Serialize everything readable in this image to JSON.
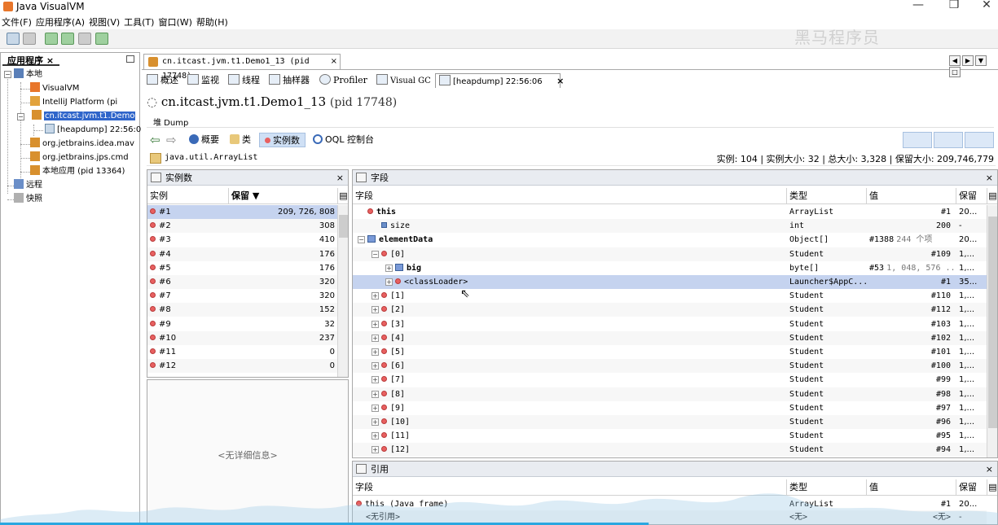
{
  "window": {
    "title": "Java VisualVM",
    "min": "—",
    "max": "❐",
    "close": "✕"
  },
  "menu": [
    "文件(F)",
    "应用程序(A)",
    "视图(V)",
    "工具(T)",
    "窗口(W)",
    "帮助(H)"
  ],
  "watermark": "黑马程序员",
  "app_panel": {
    "tab": "应用程序",
    "tab_close": "×",
    "tree": [
      {
        "label": "本地",
        "level": 0
      },
      {
        "label": "VisualVM",
        "level": 2
      },
      {
        "label": "IntelliJ Platform (pi",
        "level": 2
      },
      {
        "label": "cn.itcast.jvm.t1.Demo",
        "level": 2,
        "selected": true
      },
      {
        "label": "[heapdump] 22:56:0",
        "level": 3
      },
      {
        "label": "org.jetbrains.idea.mav",
        "level": 2
      },
      {
        "label": "org.jetbrains.jps.cmd",
        "level": 2
      },
      {
        "label": "本地应用 (pid 13364)",
        "level": 2
      },
      {
        "label": "远程",
        "level": 0
      },
      {
        "label": "快照",
        "level": 0
      }
    ]
  },
  "doc_tab": {
    "label": "cn.itcast.jvm.t1.Demo1_13 (pid 17748)",
    "close": "×"
  },
  "subtabs": [
    "概述",
    "监视",
    "线程",
    "抽样器",
    "Profiler",
    "Visual GC",
    "[heapdump] 22:56:06"
  ],
  "subtab_close": "×",
  "heading": {
    "name": "cn.itcast.jvm.t1.Demo1_13",
    "pid": "(pid 17748)"
  },
  "dump_label": "堆 Dump",
  "views": [
    "概要",
    "类",
    "实例数",
    "OQL 控制台"
  ],
  "class_bar": {
    "class_name": "java.util.ArrayList",
    "stats": "实例: 104  |  实例大小: 32  |  总大小: 3,328  |  保留大小: 209,746,779"
  },
  "instances_panel": {
    "title": "实例数",
    "close": "×",
    "columns": [
      "实例",
      "保留 ▼"
    ],
    "rows": [
      [
        "#1",
        "209, 726, 808"
      ],
      [
        "#2",
        "308"
      ],
      [
        "#3",
        "410"
      ],
      [
        "#4",
        "176"
      ],
      [
        "#5",
        "176"
      ],
      [
        "#6",
        "320"
      ],
      [
        "#7",
        "320"
      ],
      [
        "#8",
        "152"
      ],
      [
        "#9",
        "32"
      ],
      [
        "#10",
        "237"
      ],
      [
        "#11",
        "0"
      ],
      [
        "#12",
        "0"
      ]
    ],
    "detail_placeholder": "<无详细信息>"
  },
  "fields_panel": {
    "title": "字段",
    "close": "×",
    "columns": [
      "字段",
      "类型",
      "值",
      "保留"
    ],
    "rows": [
      {
        "name": "this",
        "type": "ArrayList",
        "value": "#1",
        "extra": "",
        "retained": "20...",
        "indent": 0,
        "icon": "dot",
        "toggle": ""
      },
      {
        "name": "size",
        "type": "int",
        "value": "200",
        "extra": "",
        "retained": "-",
        "indent": 1,
        "icon": "sq",
        "toggle": ""
      },
      {
        "name": "elementData",
        "type": "Object[]",
        "value": "#1388",
        "extra": "244 个项",
        "retained": "20...",
        "indent": 0,
        "icon": "arr",
        "toggle": "⊟"
      },
      {
        "name": "[0]",
        "type": "Student",
        "value": "#109",
        "extra": "",
        "retained": "1,...",
        "indent": 1,
        "icon": "dot",
        "toggle": "⊟"
      },
      {
        "name": "big",
        "type": "byte[]",
        "value": "#53",
        "extra": "1, 048, 576 ...",
        "retained": "1,...",
        "indent": 2,
        "icon": "arr",
        "toggle": "⊞"
      },
      {
        "name": "<classLoader>",
        "type": "Launcher$AppC...",
        "value": "#1",
        "extra": "",
        "retained": "35...",
        "indent": 2,
        "icon": "dot",
        "toggle": "⊞",
        "selected": true
      },
      {
        "name": "[1]",
        "type": "Student",
        "value": "#110",
        "extra": "",
        "retained": "1,...",
        "indent": 1,
        "icon": "dot",
        "toggle": "⊞"
      },
      {
        "name": "[2]",
        "type": "Student",
        "value": "#112",
        "extra": "",
        "retained": "1,...",
        "indent": 1,
        "icon": "dot",
        "toggle": "⊞"
      },
      {
        "name": "[3]",
        "type": "Student",
        "value": "#103",
        "extra": "",
        "retained": "1,...",
        "indent": 1,
        "icon": "dot",
        "toggle": "⊞"
      },
      {
        "name": "[4]",
        "type": "Student",
        "value": "#102",
        "extra": "",
        "retained": "1,...",
        "indent": 1,
        "icon": "dot",
        "toggle": "⊞"
      },
      {
        "name": "[5]",
        "type": "Student",
        "value": "#101",
        "extra": "",
        "retained": "1,...",
        "indent": 1,
        "icon": "dot",
        "toggle": "⊞"
      },
      {
        "name": "[6]",
        "type": "Student",
        "value": "#100",
        "extra": "",
        "retained": "1,...",
        "indent": 1,
        "icon": "dot",
        "toggle": "⊞"
      },
      {
        "name": "[7]",
        "type": "Student",
        "value": "#99",
        "extra": "",
        "retained": "1,...",
        "indent": 1,
        "icon": "dot",
        "toggle": "⊞"
      },
      {
        "name": "[8]",
        "type": "Student",
        "value": "#98",
        "extra": "",
        "retained": "1,...",
        "indent": 1,
        "icon": "dot",
        "toggle": "⊞"
      },
      {
        "name": "[9]",
        "type": "Student",
        "value": "#97",
        "extra": "",
        "retained": "1,...",
        "indent": 1,
        "icon": "dot",
        "toggle": "⊞"
      },
      {
        "name": "[10]",
        "type": "Student",
        "value": "#96",
        "extra": "",
        "retained": "1,...",
        "indent": 1,
        "icon": "dot",
        "toggle": "⊞"
      },
      {
        "name": "[11]",
        "type": "Student",
        "value": "#95",
        "extra": "",
        "retained": "1,...",
        "indent": 1,
        "icon": "dot",
        "toggle": "⊞"
      },
      {
        "name": "[12]",
        "type": "Student",
        "value": "#94",
        "extra": "",
        "retained": "1,...",
        "indent": 1,
        "icon": "dot",
        "toggle": "⊞"
      }
    ]
  },
  "refs_panel": {
    "title": "引用",
    "close": "×",
    "columns": [
      "字段",
      "类型",
      "值",
      "保留"
    ],
    "rows": [
      {
        "name": "this (Java frame)",
        "type": "ArrayList",
        "value": "#1",
        "retained": "20..."
      },
      {
        "name": "<无引用>",
        "type": "<无>",
        "value": "<无>",
        "retained": "-"
      }
    ]
  },
  "colors": {
    "selection": "#2f65ca",
    "row_selected": "#c5d3ef",
    "header": "#e9ecf1",
    "progress": "#2aa7e0"
  },
  "progress": 0.65
}
